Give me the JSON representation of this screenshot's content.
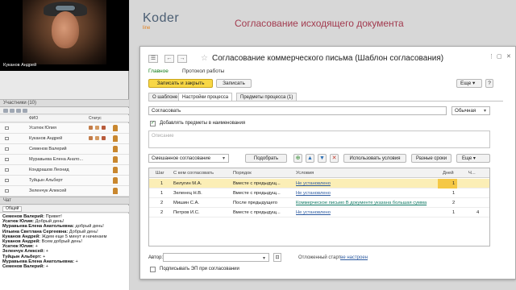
{
  "conference": {
    "video_name": "Куканов Андрей",
    "participants_title": "Участники (10)",
    "table_headers": [
      "ФИО",
      "Статус"
    ],
    "participants": [
      "Усатюк Юлия",
      "Куканов Андрей",
      "Семенов Валерий",
      "Муравьева Елена  Анато...",
      "Кондрашов Леонид",
      "Туйцын Альберт",
      "Зеленчук Алексей"
    ],
    "chat_title": "Чат",
    "chat_tab": "Общий",
    "chat": [
      {
        "who": "Семенов Валерий:",
        "text": " Привет!"
      },
      {
        "who": "Усатюк Юлия:",
        "text": " Добрый день!"
      },
      {
        "who": "Муравьева Елена  Анатольевна:",
        "text": " добрый день!"
      },
      {
        "who": "Ильина Светлана Сергеевна:",
        "text": " Добрый день!"
      },
      {
        "who": "Куканов Андрей:",
        "text": " Ждем еще 5 минут и начинаем"
      },
      {
        "who": "Куканов Андрей:",
        "text": " Всем добрый день!"
      },
      {
        "who": "Усатюк Юлия:",
        "text": " +"
      },
      {
        "who": "Зеленчук Алексей:",
        "text": " +"
      },
      {
        "who": "Туйцын Альберт:",
        "text": " +"
      },
      {
        "who": "Муравьева Елена  Анатольевна:",
        "text": " +"
      },
      {
        "who": "Семенов Валерий:",
        "text": " +"
      }
    ]
  },
  "brand": {
    "koder": "Koder",
    "line": "line"
  },
  "page_title": "Согласование исходящего документа",
  "form": {
    "title": "Согласование коммерческого письма (Шаблон согласования)",
    "nav_main": "Главное",
    "nav_protocol": "Протокол работы",
    "save_close": "Записать и закрыть",
    "save": "Записать",
    "more": "Еще",
    "help": "?",
    "tabs": [
      "О шаблоне",
      "Настройки процесса",
      "Предметы процесса (1)"
    ],
    "name_value": "Согласовать",
    "kind_value": "Обычная",
    "add_subjects_label": "Добавлять предметы в наименования",
    "comment_placeholder": "Описание",
    "mode_value": "Смешанное согласование",
    "pick": "Подобрать",
    "use_conditions": "Использовать условия",
    "diff_terms": "Разные сроки",
    "more2": "Еще",
    "grid_headers": [
      "Шаг",
      "С кем согласовать",
      "Порядок",
      "Условия",
      "Дней",
      "Ч..."
    ],
    "rows": [
      {
        "step": "1",
        "who": "Белугин М.А.",
        "order": "Вместе с предыдущ...",
        "cond": "Не установлено",
        "days": "1",
        "hours": ""
      },
      {
        "step": "1",
        "who": "Зеленец Н.В.",
        "order": "Вместе с предыдущ...",
        "cond": "Не установлено",
        "days": "1",
        "hours": ""
      },
      {
        "step": "2",
        "who": "Мишин С.А.",
        "order": "После предыдущего",
        "cond": "Коммерческое письмо В документе указана большая сумма",
        "days": "2",
        "hours": ""
      },
      {
        "step": "2",
        "who": "Петров И.С.",
        "order": "Вместе с предыдущ...",
        "cond": "Не установлено",
        "days": "1",
        "hours": "4"
      }
    ],
    "author_label": "Автор:",
    "delayed_start_label": "Отложенный старт:",
    "delayed_start_value": "не настроен",
    "sign_label": "Подписывать ЭП при согласовании"
  }
}
